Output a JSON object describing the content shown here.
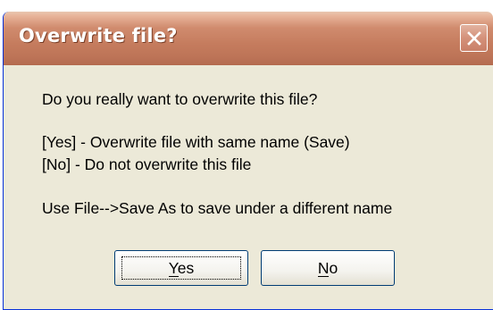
{
  "dialog": {
    "title": "Overwrite file?",
    "close_icon": "close-icon",
    "question": "Do you really want to overwrite this file?",
    "yes_help": "[Yes] - Overwrite file with same name (Save)",
    "no_help": "[No] - Do not overwrite this file",
    "save_as_hint": "Use File-->Save As to save under a different name",
    "buttons": {
      "yes_label": "Yes",
      "no_label": "No"
    }
  },
  "colors": {
    "titlebar": "#c57c5e",
    "dialog_background": "#ece9d8",
    "title_text": "#ffffff"
  }
}
